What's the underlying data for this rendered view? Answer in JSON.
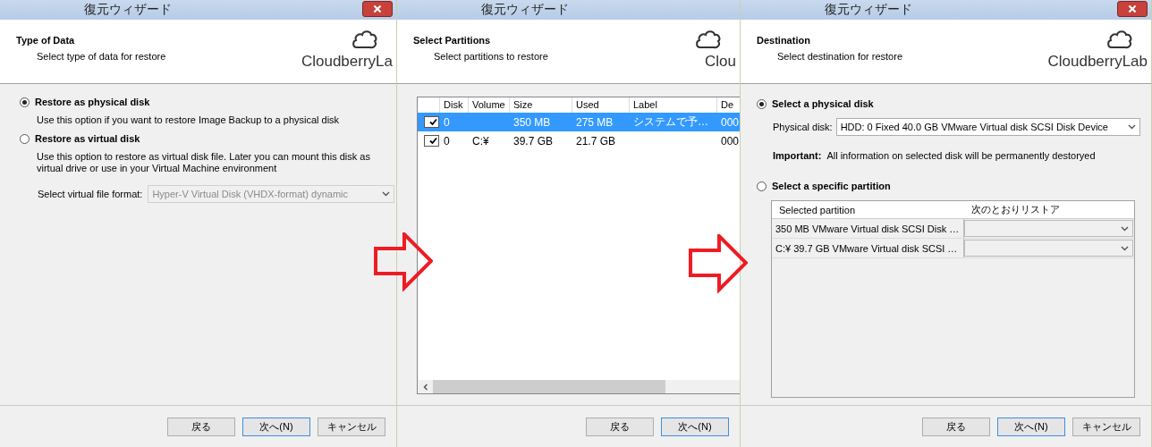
{
  "wizards": [
    {
      "kind": "type",
      "title": "復元ウィザード",
      "close_button": true,
      "heading": "Type of Data",
      "subheading": "Select type of data for restore",
      "logo_text": "CloudberryLa",
      "options": [
        {
          "label": "Restore as physical disk",
          "description": "Use this option if you want to restore Image Backup to a physical disk",
          "selected": true
        },
        {
          "label": "Restore as virtual disk",
          "description": "Use this option to restore as virtual disk file. Later you can mount this disk as virtual drive or use in your Virtual Machine environment",
          "selected": false
        }
      ],
      "format": {
        "label": "Select virtual file format:",
        "value": "Hyper-V Virtual Disk (VHDX-format) dynamic",
        "disabled": true
      },
      "buttons": [
        {
          "label": "戻る",
          "default": false
        },
        {
          "label": "次へ(N)",
          "default": true
        },
        {
          "label": "キャンセル",
          "default": false
        }
      ]
    },
    {
      "kind": "partitions",
      "title": "復元ウィザード",
      "close_button": false,
      "heading": "Select Partitions",
      "subheading": "Select partitions to restore",
      "logo_text": "Clou",
      "table": {
        "columns": [
          "Disk",
          "Volume",
          "Size",
          "Used",
          "Label",
          "De"
        ],
        "rows": [
          {
            "checked": true,
            "selected": true,
            "cells": [
              "0",
              "",
              "350 MB",
              "275 MB",
              "システムで予…",
              "000"
            ]
          },
          {
            "checked": true,
            "selected": false,
            "cells": [
              "0",
              "C:¥",
              "39.7 GB",
              "21.7 GB",
              "",
              "000"
            ]
          }
        ]
      },
      "buttons": [
        {
          "label": "戻る",
          "default": false
        },
        {
          "label": "次へ(N)",
          "default": true
        }
      ]
    },
    {
      "kind": "destination",
      "title": "復元ウィザード",
      "close_button": true,
      "heading": "Destination",
      "subheading": "Select destination for restore",
      "logo_text": "CloudberryLab",
      "disk_option": {
        "label": "Select a physical disk",
        "selected": true
      },
      "disk": {
        "label": "Physical disk:",
        "value": "HDD: 0 Fixed 40.0 GB VMware Virtual disk SCSI Disk Device"
      },
      "important": {
        "label": "Important:",
        "text": "All information on selected disk will be permanently destoryed"
      },
      "partition_option": {
        "label": "Select a specific partition",
        "selected": false
      },
      "grid": {
        "columns": [
          "Selected partition",
          "次のとおりリストア"
        ],
        "rows": [
          "350 MB VMware Virtual disk SCSI Disk …",
          "C:¥ 39.7 GB VMware Virtual disk SCSI …"
        ]
      },
      "buttons": [
        {
          "label": "戻る",
          "default": false
        },
        {
          "label": "次へ(N)",
          "default": true
        },
        {
          "label": "キャンセル",
          "default": false
        }
      ]
    }
  ]
}
